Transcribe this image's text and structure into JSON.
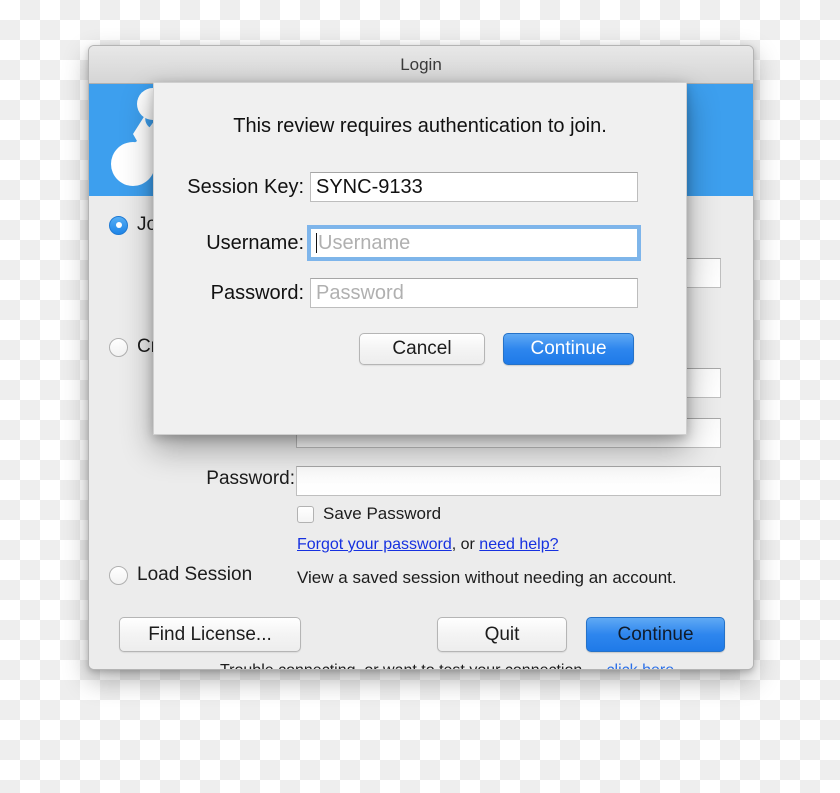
{
  "window": {
    "title": "Login",
    "banner_color": "#3d9fee",
    "logo_icon": "molecule-logo-icon"
  },
  "background_form": {
    "options": [
      {
        "id": "join",
        "label": "Jo",
        "selected": true
      },
      {
        "id": "create",
        "label": "Cr",
        "selected": false
      },
      {
        "id": "load",
        "label": "Load Session",
        "selected": false,
        "description": "View a saved session without needing an account."
      }
    ],
    "password_label": "Password:",
    "save_password": {
      "label": "Save Password",
      "checked": false
    },
    "links": {
      "forgot": "Forgot your password",
      "separator": ", or ",
      "help": "need help?"
    }
  },
  "bottom_bar": {
    "find_license_label": "Find License...",
    "quit_label": "Quit",
    "continue_label": "Continue",
    "footer_text": "Trouble connecting, or want to test your connection -",
    "footer_link": "click here"
  },
  "modal": {
    "message": "This review requires authentication to join.",
    "fields": [
      {
        "id": "session-key",
        "label": "Session Key:",
        "value": "SYNC-9133",
        "placeholder": "",
        "focused": false
      },
      {
        "id": "username",
        "label": "Username:",
        "value": "",
        "placeholder": "Username",
        "focused": true
      },
      {
        "id": "password",
        "label": "Password:",
        "value": "",
        "placeholder": "Password",
        "focused": false
      }
    ],
    "cancel_label": "Cancel",
    "continue_label": "Continue",
    "accent_color": "#2e86ee"
  }
}
